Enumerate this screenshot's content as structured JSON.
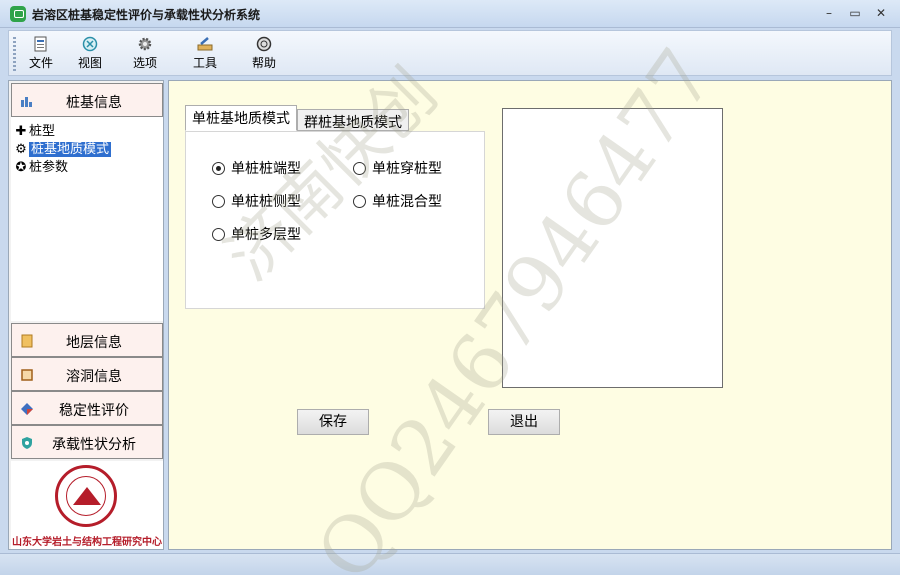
{
  "window": {
    "title": "岩溶区桩基稳定性评价与承载性状分析系统"
  },
  "window_controls": {
    "minimize": "–",
    "maximize": "▭",
    "close": "✕"
  },
  "toolbar": {
    "items": [
      {
        "label": "文件",
        "icon": "file-icon"
      },
      {
        "label": "视图",
        "icon": "view-icon"
      },
      {
        "label": "选项",
        "icon": "options-gear-icon"
      },
      {
        "label": "工具",
        "icon": "tools-icon"
      },
      {
        "label": "帮助",
        "icon": "help-icon"
      }
    ]
  },
  "sidebar": {
    "top_header": "桩基信息",
    "tree": [
      {
        "label": "桩型",
        "icon": "plus-icon",
        "glyph": "✚",
        "selected": false
      },
      {
        "label": "桩基地质模式",
        "icon": "gear-icon",
        "glyph": "⚙",
        "selected": true
      },
      {
        "label": "桩参数",
        "icon": "star-circle-icon",
        "glyph": "✪",
        "selected": false
      }
    ],
    "headers": [
      {
        "label": "地层信息",
        "icon": "scroll-icon"
      },
      {
        "label": "溶洞信息",
        "icon": "box-icon"
      },
      {
        "label": "稳定性评价",
        "icon": "diamond-icon"
      },
      {
        "label": "承载性状分析",
        "icon": "shield-icon"
      }
    ],
    "logo_caption": "山东大学岩土与结构工程研究中心"
  },
  "main": {
    "tabs": [
      "单桩基地质模式",
      "群桩基地质模式"
    ],
    "active_tab": 0,
    "options": [
      {
        "label": "单桩桩端型",
        "checked": true
      },
      {
        "label": "单桩穿桩型",
        "checked": false
      },
      {
        "label": "单桩桩侧型",
        "checked": false
      },
      {
        "label": "单桩混合型",
        "checked": false
      },
      {
        "label": "单桩多层型",
        "checked": false
      }
    ],
    "save_label": "保存",
    "exit_label": "退出"
  },
  "watermark": {
    "line1": "济南快创",
    "line2": "QQ2467946477"
  },
  "colors": {
    "accent": "#2f6fcf",
    "main_bg": "#fefde3",
    "nav_head_bg": "#fdf1ee",
    "logo_red": "#b51d2a"
  }
}
